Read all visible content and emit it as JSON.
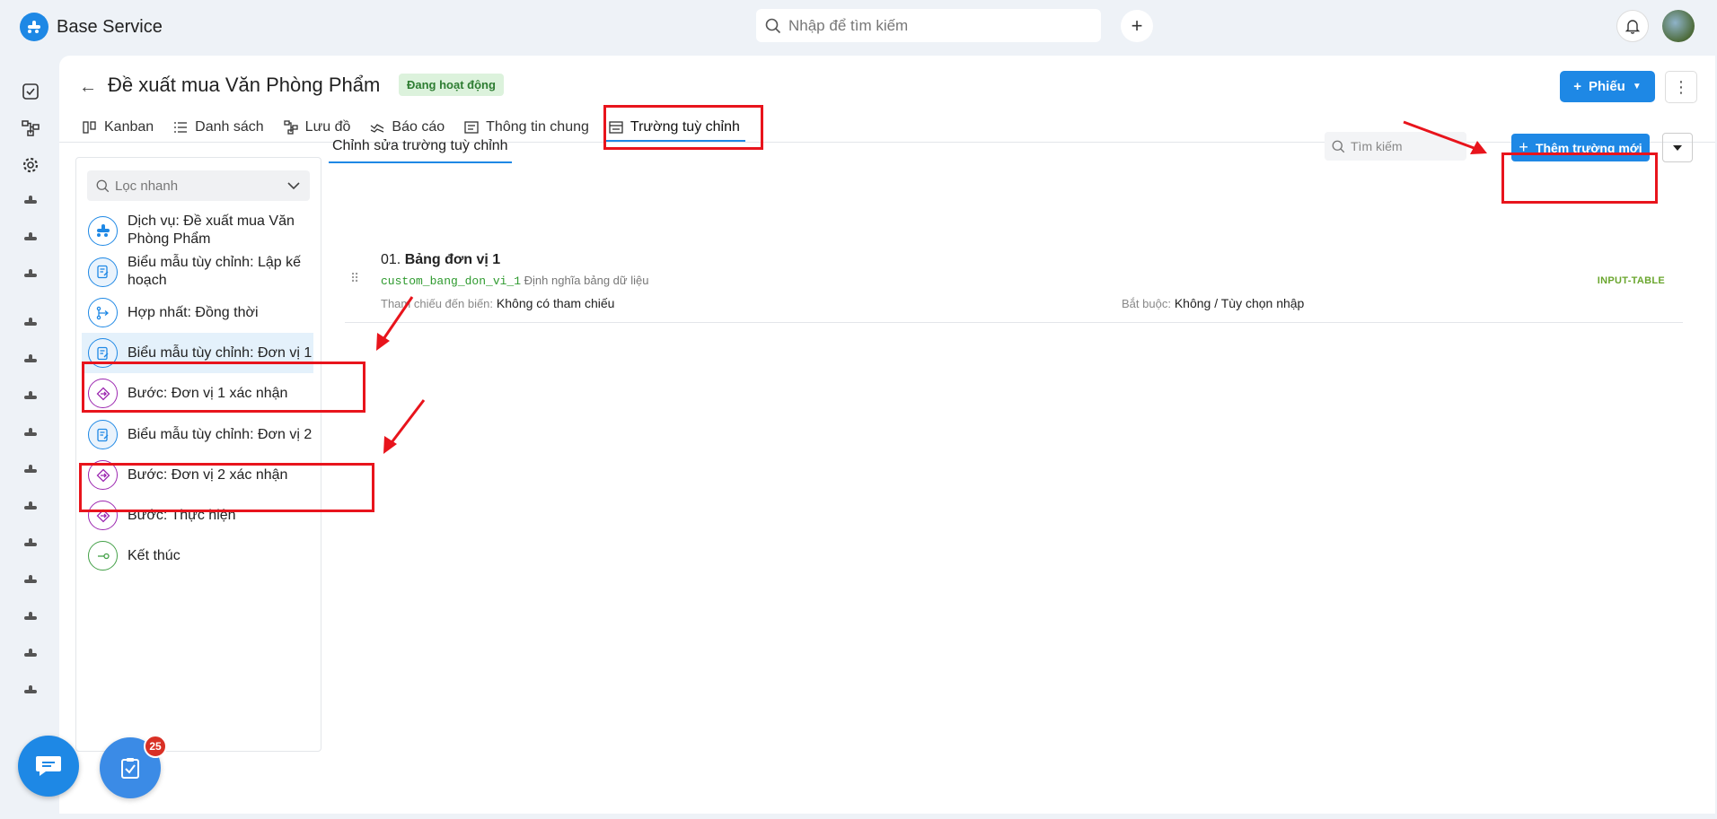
{
  "app": {
    "brand": "Base Service"
  },
  "search": {
    "placeholder": "Nhập để tìm kiếm"
  },
  "page": {
    "title": "Đề xuất mua Văn Phòng Phẩm",
    "status": "Đang hoạt động",
    "new_button": "Phiếu"
  },
  "tabs": [
    {
      "label": "Kanban",
      "icon": "kanban-icon"
    },
    {
      "label": "Danh sách",
      "icon": "list-icon"
    },
    {
      "label": "Lưu đồ",
      "icon": "flowchart-icon"
    },
    {
      "label": "Báo cáo",
      "icon": "report-icon"
    },
    {
      "label": "Thông tin chung",
      "icon": "info-icon"
    },
    {
      "label": "Trường tuỳ chỉnh",
      "icon": "custom-field-icon",
      "active": true
    }
  ],
  "sidebar": {
    "filter_placeholder": "Lọc nhanh",
    "items": [
      {
        "label": "Dịch vụ: Đề xuất mua Văn Phòng Phẩm",
        "icon": "service-icon"
      },
      {
        "label": "Biểu mẫu tùy chỉnh: Lập kế hoạch",
        "icon": "form-icon"
      },
      {
        "label": "Hợp nhất: Đồng thời",
        "icon": "merge-icon"
      },
      {
        "label": "Biểu mẫu tùy chỉnh: Đơn vị 1",
        "icon": "form-icon",
        "selected": true
      },
      {
        "label": "Bước: Đơn vị 1 xác nhận",
        "icon": "step-icon"
      },
      {
        "label": "Biểu mẫu tùy chỉnh: Đơn vị 2",
        "icon": "form-icon"
      },
      {
        "label": "Bước: Đơn vị 2 xác nhận",
        "icon": "step-icon"
      },
      {
        "label": "Bước: Thực hiện",
        "icon": "step-icon"
      },
      {
        "label": "Kết thúc",
        "icon": "end-icon"
      }
    ]
  },
  "content": {
    "tab_label": "Chỉnh sửa trường tuỳ chỉnh",
    "search_placeholder": "Tìm kiếm",
    "add_button": "Thêm trường mới",
    "fields": [
      {
        "index": "01.",
        "name": "Bảng đơn vị 1",
        "code": "custom_bang_don_vi_1",
        "description": "Định nghĩa bảng dữ liệu",
        "ref_label": "Tham chiếu đến biến:",
        "ref_value": "Không có tham chiếu",
        "required_label": "Bắt buộc:",
        "required_value": "Không / Tùy chọn nhập",
        "type": "INPUT-TABLE"
      }
    ]
  },
  "floating": {
    "task_count": "25"
  },
  "colors": {
    "primary": "#1e88e5",
    "highlight": "#e8141c",
    "status_bg": "#dcf2dc",
    "status_text": "#2e7d32"
  }
}
